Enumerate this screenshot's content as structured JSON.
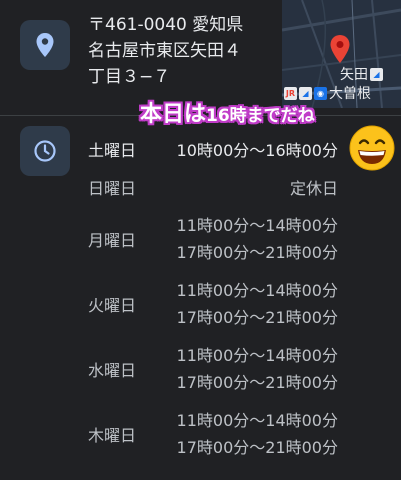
{
  "address": {
    "lines": [
      "〒461-0040 愛知県",
      "名古屋市東区矢田４",
      "丁目３−７"
    ]
  },
  "map": {
    "station1": "矢田",
    "station2": "大曽根",
    "badge_jr": "JR",
    "pin_color": "#ea4335"
  },
  "sticker": {
    "big": "本日は",
    "small": "16時までだね",
    "color": "#c03cc8"
  },
  "hours": {
    "today_day": "土曜日",
    "today_time": "10時00分〜16時00分",
    "rows": [
      {
        "day": "日曜日",
        "times": [
          "定休日"
        ]
      },
      {
        "day": "月曜日",
        "times": [
          "11時00分〜14時00分",
          "17時00分〜21時00分"
        ]
      },
      {
        "day": "火曜日",
        "times": [
          "11時00分〜14時00分",
          "17時00分〜21時00分"
        ]
      },
      {
        "day": "水曜日",
        "times": [
          "11時00分〜14時00分",
          "17時00分〜21時00分"
        ]
      },
      {
        "day": "木曜日",
        "times": [
          "11時00分〜14時00分",
          "17時00分〜21時00分"
        ]
      }
    ]
  }
}
